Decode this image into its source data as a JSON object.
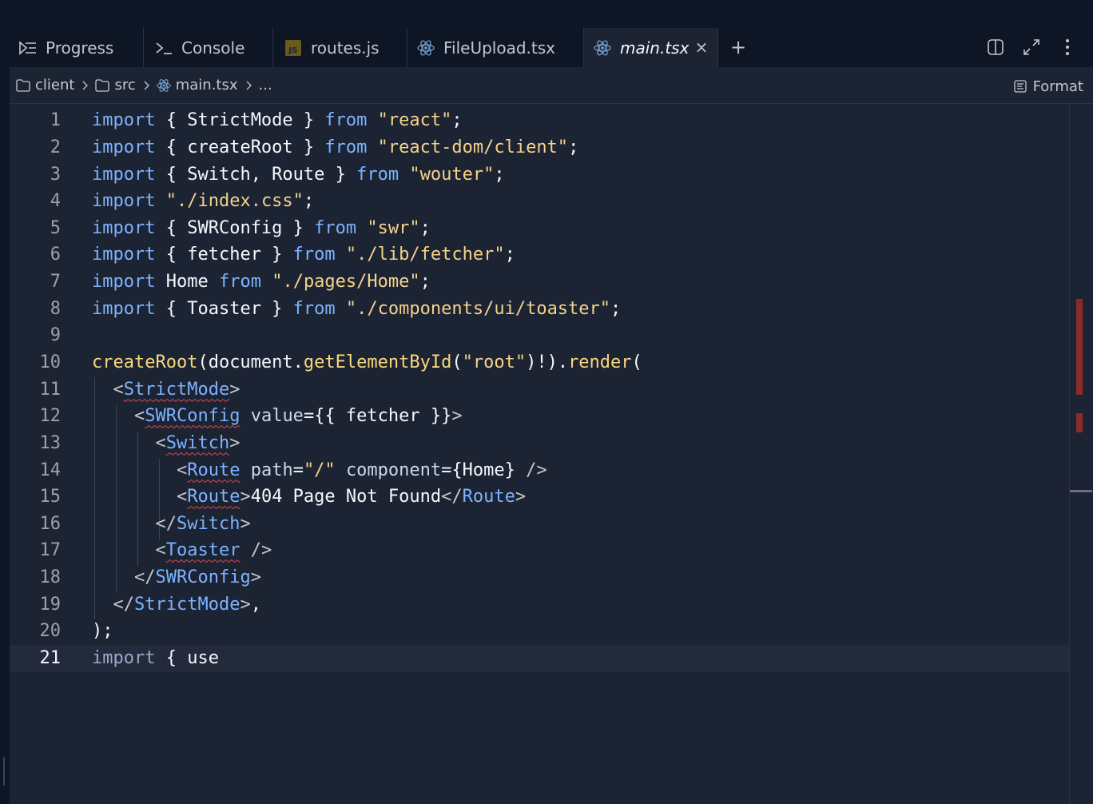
{
  "tabs": [
    {
      "label": "Progress",
      "icon": "progress-icon"
    },
    {
      "label": "Console",
      "icon": "console-icon"
    },
    {
      "label": "routes.js",
      "icon": "js-file-icon"
    },
    {
      "label": "FileUpload.tsx",
      "icon": "react-icon"
    },
    {
      "label": "main.tsx",
      "icon": "react-icon",
      "active": true,
      "close": "×"
    }
  ],
  "add_tab": "+",
  "toolbar": {
    "split_icon": "split-pane-icon",
    "expand_icon": "expand-icon",
    "more_icon": "more-vertical-icon"
  },
  "breadcrumb": {
    "items": [
      "client",
      "src",
      "main.tsx",
      "..."
    ],
    "format_label": "Format"
  },
  "editor": {
    "line_numbers": [
      "1",
      "2",
      "3",
      "4",
      "5",
      "6",
      "7",
      "8",
      "9",
      "10",
      "11",
      "12",
      "13",
      "14",
      "15",
      "16",
      "17",
      "18",
      "19",
      "20",
      "21"
    ],
    "current_line": "21",
    "lines": [
      "import { StrictMode } from \"react\";",
      "import { createRoot } from \"react-dom/client\";",
      "import { Switch, Route } from \"wouter\";",
      "import \"./index.css\";",
      "import { SWRConfig } from \"swr\";",
      "import { fetcher } from \"./lib/fetcher\";",
      "import Home from \"./pages/Home\";",
      "import { Toaster } from \"./components/ui/toaster\";",
      "",
      "createRoot(document.getElementById(\"root\")!).render(",
      "  <StrictMode>",
      "    <SWRConfig value={{ fetcher }}>",
      "      <Switch>",
      "        <Route path=\"/\" component={Home} />",
      "        <Route>404 Page Not Found</Route>",
      "      </Switch>",
      "      <Toaster />",
      "    </SWRConfig>",
      "  </StrictMode>,",
      ");",
      "import { use"
    ]
  },
  "colors": {
    "background": "#1c2333",
    "tabbar": "#0e1525",
    "keyword": "#7cb3ff",
    "string": "#f5d38a",
    "error_marker": "#8b2a2a"
  }
}
